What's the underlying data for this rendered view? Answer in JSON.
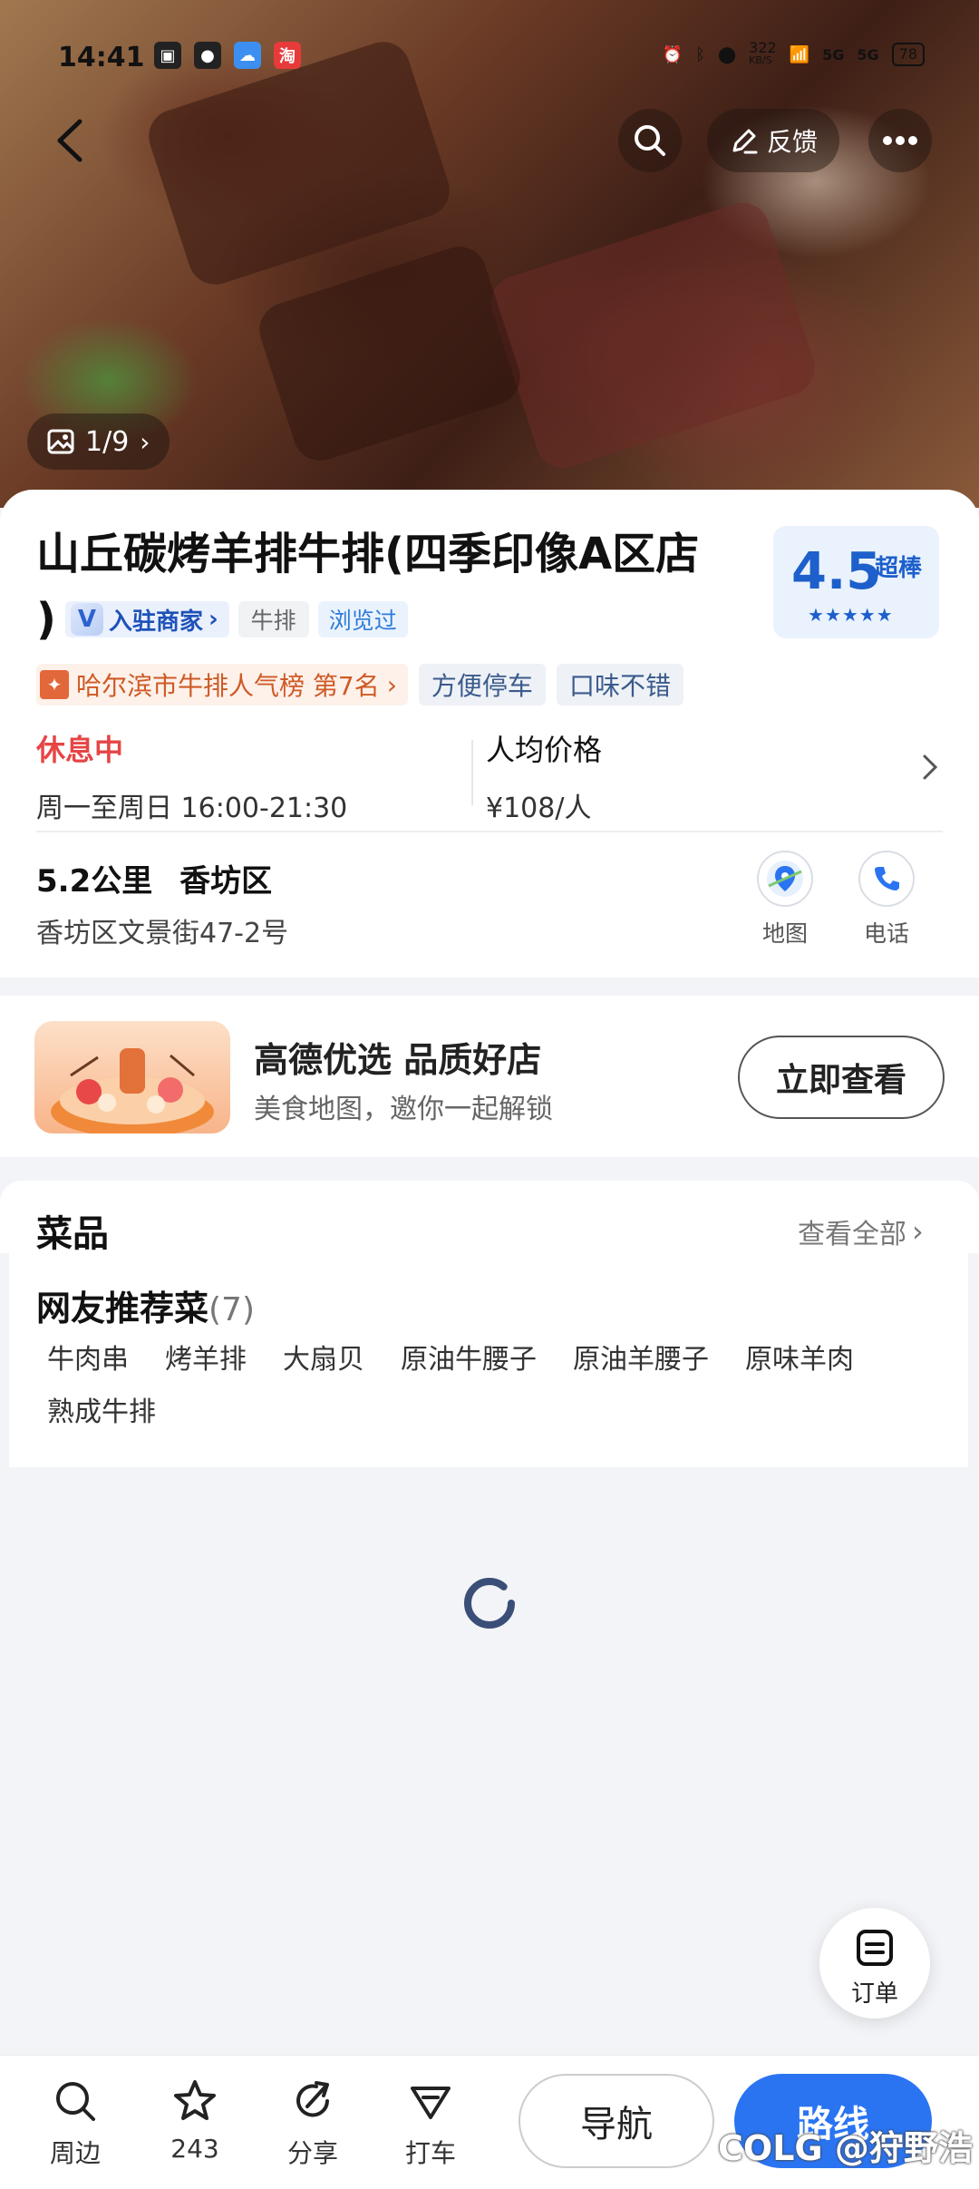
{
  "status_bar": {
    "time": "14:41",
    "speed_top": "322",
    "speed_bottom": "KB/S",
    "network_1": "5G",
    "network_2": "5G",
    "battery": "78"
  },
  "header": {
    "feedback_label": "反馈",
    "photo_counter": "1/9"
  },
  "shop": {
    "title": "山丘碳烤羊排牛排(四季印像A区店",
    "title_close": ")",
    "merchant_badge": "入驻商家",
    "category_tag": "牛排",
    "viewed_tag": "浏览过",
    "rating_score": "4.5",
    "rating_label": "超棒",
    "rating_stars": 4.5,
    "rank_tag": "哈尔滨市牛排人气榜 第7名",
    "feature_tags": [
      "方便停车",
      "口味不错"
    ],
    "status": "休息中",
    "hours": "周一至周日 16:00-21:30",
    "price_label": "人均价格",
    "price_value": "¥108/人",
    "distance": "5.2公里",
    "district": "香坊区",
    "address": "香坊区文景街47-2号",
    "map_label": "地图",
    "phone_label": "电话"
  },
  "promo": {
    "title": "高德优选 品质好店",
    "subtitle": "美食地图，邀你一起解锁",
    "button": "立即查看"
  },
  "dishes": {
    "section_title": "菜品",
    "see_all": "查看全部",
    "recommended_title": "网友推荐菜",
    "recommended_count": "(7)",
    "items": [
      "牛肉串",
      "烤羊排",
      "大扇贝",
      "原油牛腰子",
      "原油羊腰子",
      "原味羊肉",
      "熟成牛排"
    ]
  },
  "order_fab": {
    "label": "订单"
  },
  "bottom_bar": {
    "nearby": "周边",
    "favorite_count": "243",
    "share": "分享",
    "taxi": "打车",
    "navigate": "导航",
    "route": "路线"
  },
  "watermark": "COLG @狩野浩",
  "colors": {
    "accent_blue": "#2a74f2",
    "closed_red": "#e64545",
    "rating_blue": "#1d5fcb",
    "rank_orange": "#cf5a25"
  }
}
